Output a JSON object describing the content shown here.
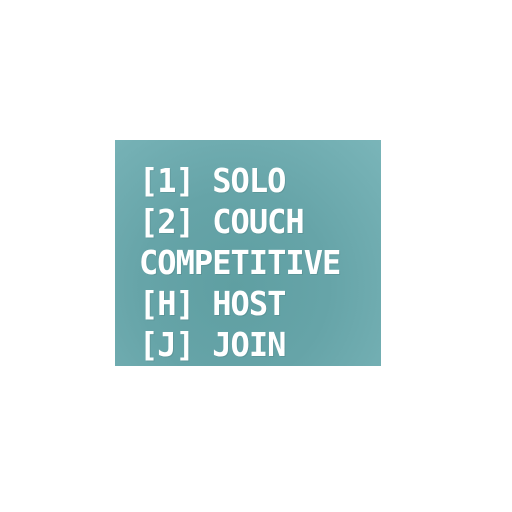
{
  "menu": {
    "items": [
      {
        "key": "[1]",
        "label": "SOLO"
      },
      {
        "key": "[2]",
        "label": "COUCH"
      },
      {
        "key": "",
        "label": "COMPETITIVE"
      },
      {
        "key": "[H]",
        "label": "HOST"
      },
      {
        "key": "[J]",
        "label": "JOIN"
      }
    ]
  },
  "colors": {
    "panel": "#66a4a8",
    "text": "#ffffff",
    "background": "#ffffff"
  }
}
